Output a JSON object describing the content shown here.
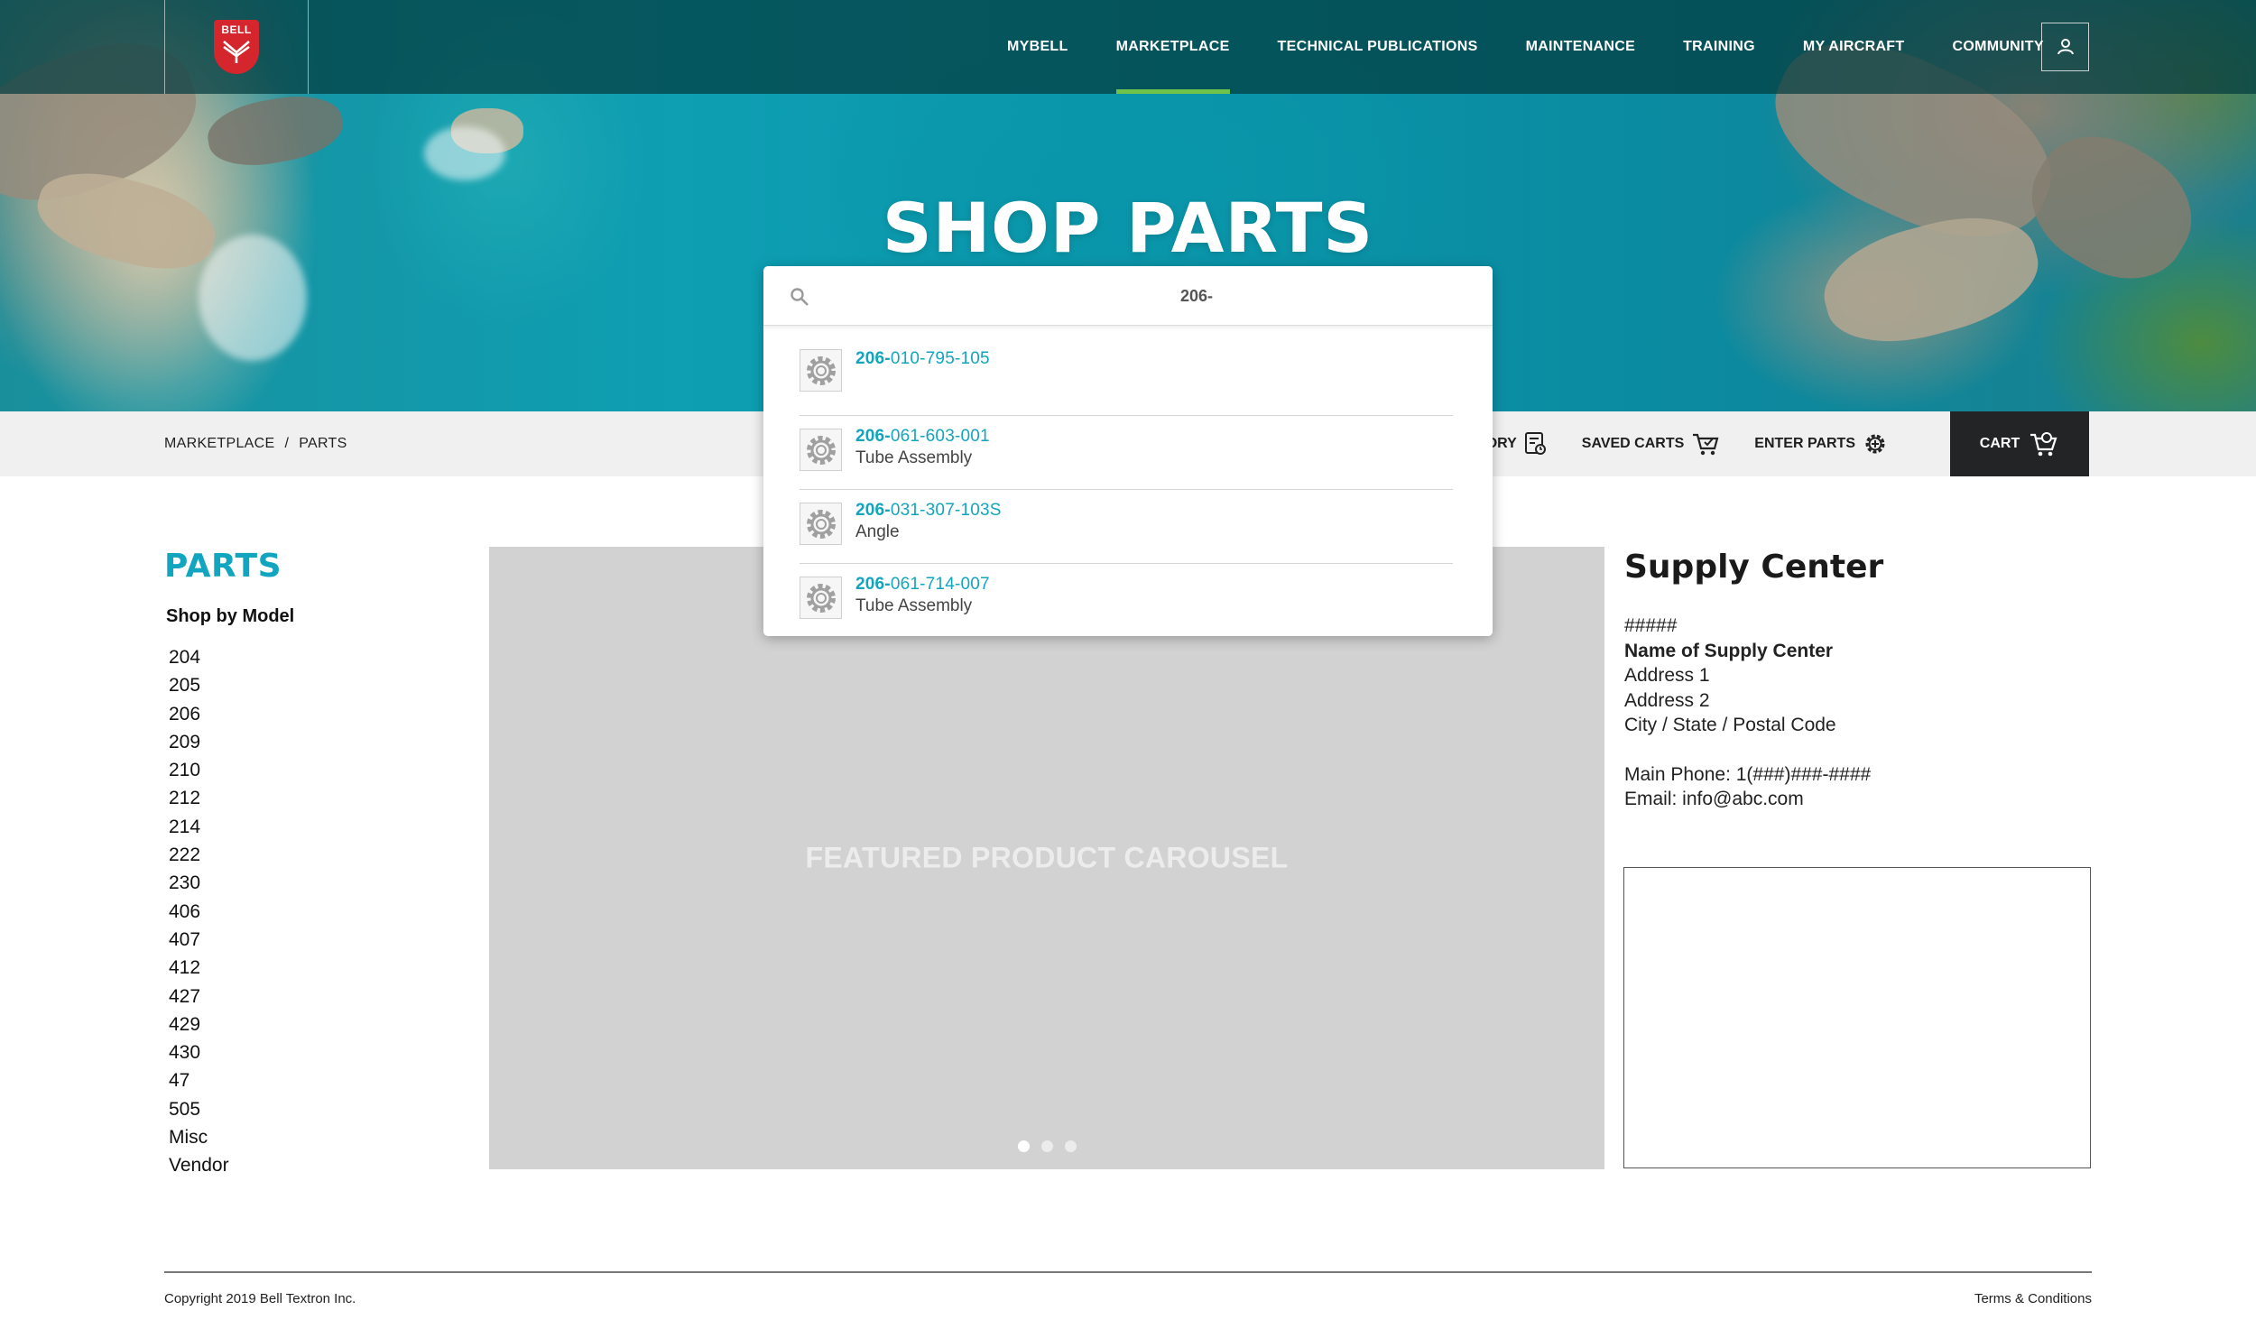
{
  "header": {
    "logo_text": "BELL",
    "nav": [
      {
        "label": "MYBELL",
        "active": false
      },
      {
        "label": "MARKETPLACE",
        "active": true
      },
      {
        "label": "TECHNICAL PUBLICATIONS",
        "active": false
      },
      {
        "label": "MAINTENANCE",
        "active": false
      },
      {
        "label": "TRAINING",
        "active": false
      },
      {
        "label": "MY AIRCRAFT",
        "active": false
      },
      {
        "label": "COMMUNITY",
        "active": false
      }
    ],
    "user_icon": "user-icon",
    "accent_color": "#6fc24a"
  },
  "hero": {
    "title": "SHOP PARTS"
  },
  "search": {
    "query": "206-",
    "results": [
      {
        "prefix": "206-",
        "rest": "010-795-105",
        "description": ""
      },
      {
        "prefix": "206-",
        "rest": "061-603-001",
        "description": "Tube Assembly"
      },
      {
        "prefix": "206-",
        "rest": "031-307-103S",
        "description": "Angle"
      },
      {
        "prefix": "206-",
        "rest": "061-714-007",
        "description": "Tube Assembly"
      }
    ]
  },
  "toolbar": {
    "breadcrumb": [
      "MARKETPLACE",
      "/",
      "PARTS"
    ],
    "history_label": "HISTORY",
    "saved_carts_label": "SAVED CARTS",
    "enter_parts_label": "ENTER PARTS",
    "cart_label": "CART"
  },
  "sidebar": {
    "title": "PARTS",
    "subtitle": "Shop by Model",
    "models": [
      "204",
      "205",
      "206",
      "209",
      "210",
      "212",
      "214",
      "222",
      "230",
      "406",
      "407",
      "412",
      "427",
      "429",
      "430",
      "47",
      "505",
      "Misc",
      "Vendor"
    ]
  },
  "carousel": {
    "label": "FEATURED PRODUCT CAROUSEL",
    "slides": 3,
    "active_slide": 1
  },
  "supply_center": {
    "title": "Supply Center",
    "number": "#####",
    "name": "Name of Supply Center",
    "address1": "Address 1",
    "address2": "Address 2",
    "city_line": "City / State / Postal Code",
    "phone": "Main Phone: 1(###)###-####",
    "email": "Email: info@abc.com"
  },
  "footer": {
    "copyright": "Copyright 2019 Bell Textron Inc.",
    "terms": "Terms & Conditions"
  },
  "colors": {
    "brand_teal": "#12a5c0",
    "cart_bg": "#222426",
    "logo_red": "#d4262c"
  }
}
